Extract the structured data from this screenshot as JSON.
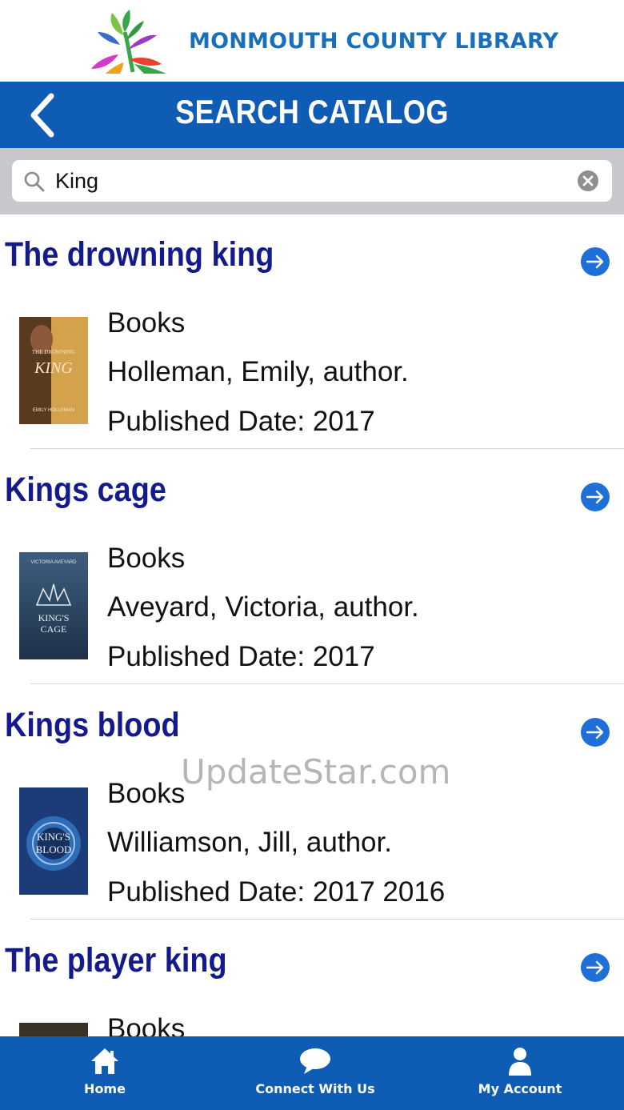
{
  "brand": {
    "name": "MONMOUTH COUNTY LIBRARY",
    "logo_icon": "library-tree-logo"
  },
  "titlebar": {
    "title": "SEARCH CATALOG",
    "back_icon": "chevron-left-icon"
  },
  "search": {
    "value": "King",
    "icon": "search-icon",
    "clear_icon": "clear-circle-icon"
  },
  "results": [
    {
      "title": "The drowning king",
      "format": "Books",
      "author": "Holleman, Emily, author.",
      "published": "Published Date: 2017",
      "cover_color": "#c9953a"
    },
    {
      "title": "Kings cage",
      "format": "Books",
      "author": "Aveyard, Victoria, author.",
      "published": "Published Date: 2017",
      "cover_color": "#2f4a66"
    },
    {
      "title": "Kings blood",
      "format": "Books",
      "author": "Williamson, Jill, author.",
      "published": "Published Date: 2017 2016",
      "cover_color": "#1b3c78"
    },
    {
      "title": "The player king",
      "format": "Books",
      "author": "",
      "published": "",
      "cover_color": "#6d5a42"
    }
  ],
  "watermark": "UpdateStar.com",
  "tabbar": {
    "home": {
      "label": "Home",
      "icon": "home-icon"
    },
    "connect": {
      "label": "Connect With Us",
      "icon": "chat-bubble-icon"
    },
    "account": {
      "label": "My Account",
      "icon": "person-icon"
    }
  },
  "colors": {
    "primary": "#0e5cb3",
    "title_text": "#141a8c",
    "brand_text": "#1a6fba",
    "go_button": "#1f6fd8"
  }
}
